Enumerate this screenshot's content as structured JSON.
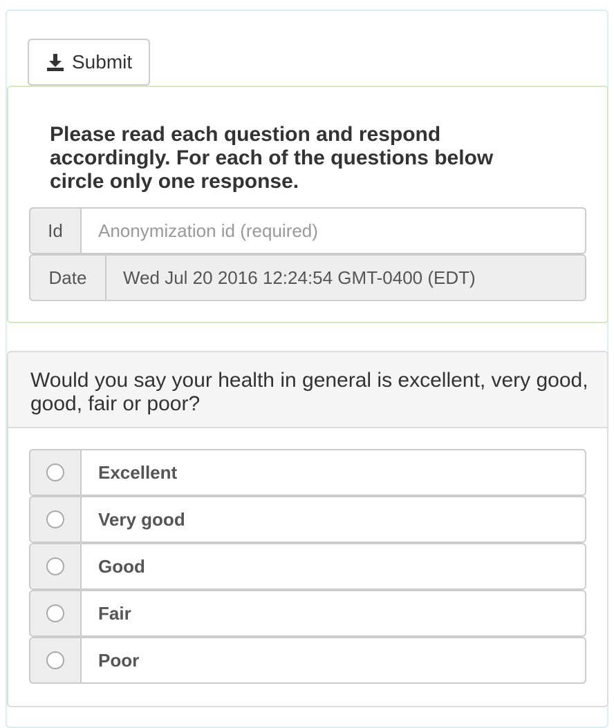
{
  "toolbar": {
    "submit_label": "Submit",
    "submit_icon": "download-icon"
  },
  "intro": {
    "text": "Please read each question and respond accordingly. For each of the questions below circle only one response."
  },
  "form": {
    "id_label": "Id",
    "id_value": "",
    "id_placeholder": "Anonymization id (required)",
    "date_label": "Date",
    "date_value": "Wed Jul 20 2016 12:24:54 GMT-0400 (EDT)"
  },
  "question": {
    "text": "Would you say your health in general is excellent, very good, good, fair or poor?",
    "options": [
      {
        "label": "Excellent",
        "selected": false
      },
      {
        "label": "Very good",
        "selected": false
      },
      {
        "label": "Good",
        "selected": false
      },
      {
        "label": "Fair",
        "selected": false
      },
      {
        "label": "Poor",
        "selected": false
      }
    ]
  },
  "colors": {
    "intro_border": "#d6e9c6",
    "outer_border": "#d9eef3",
    "addon_bg": "#eeeeee",
    "heading_bg": "#f5f5f5"
  }
}
